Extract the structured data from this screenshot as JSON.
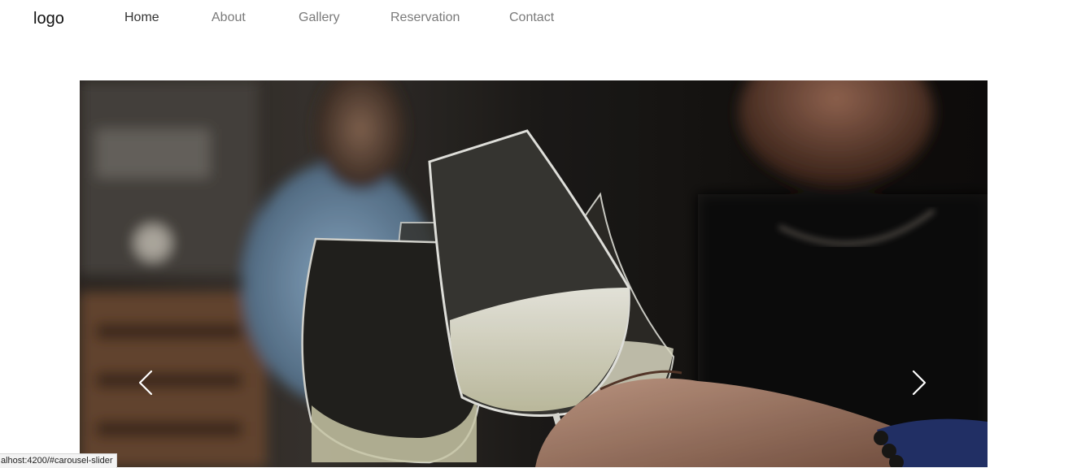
{
  "navbar": {
    "logo": "logo",
    "items": [
      {
        "label": "Home",
        "active": true
      },
      {
        "label": "About",
        "active": false
      },
      {
        "label": "Gallery",
        "active": false
      },
      {
        "label": "Reservation",
        "active": false
      },
      {
        "label": "Contact",
        "active": false
      }
    ]
  },
  "carousel": {
    "image_subject": "friends toasting with glasses of white wine",
    "prev_icon": "chevron-left-icon",
    "next_icon": "chevron-right-icon"
  },
  "status_bar": {
    "url": "alhost:4200/#carousel-slider"
  },
  "colors": {
    "nav_text": "#7a7a7a",
    "nav_active": "#333333",
    "logo": "#111111",
    "arrow": "#ffffff"
  }
}
